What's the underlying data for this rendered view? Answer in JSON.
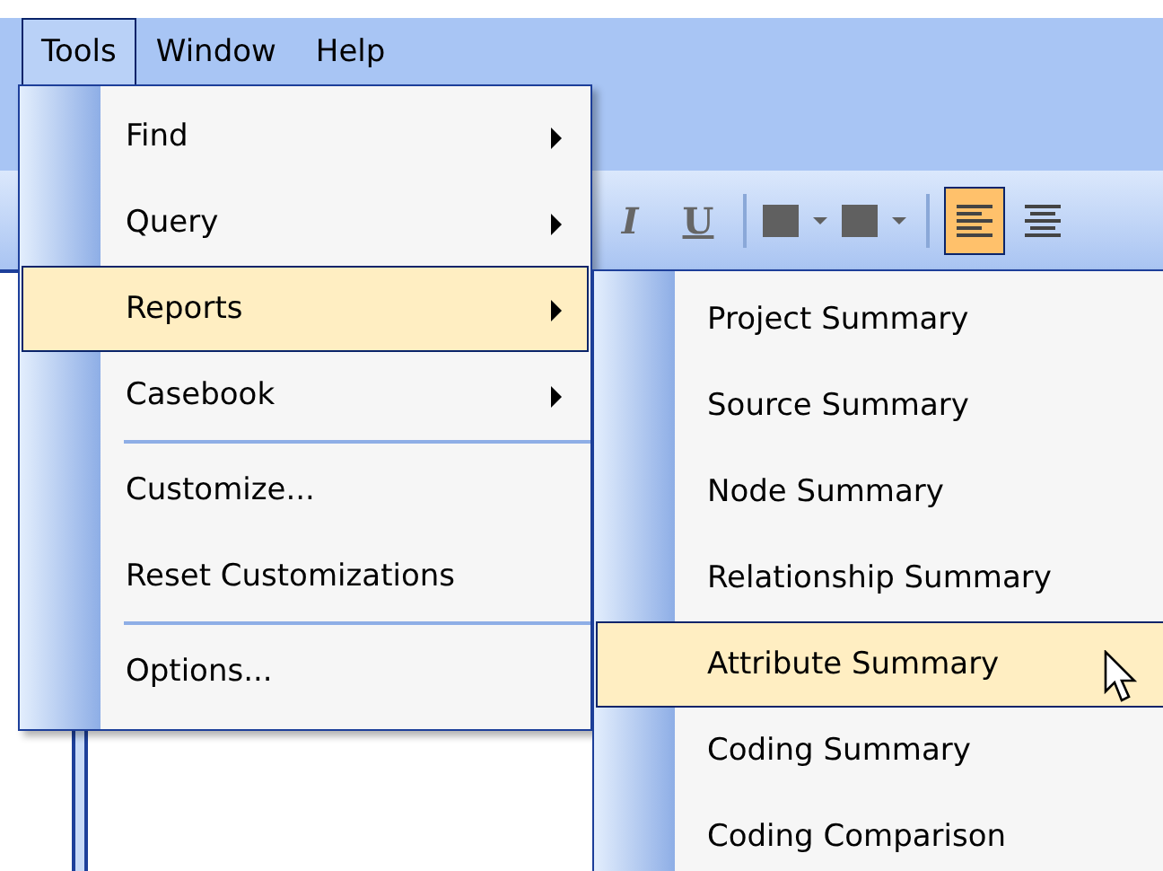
{
  "menubar": [
    {
      "label": "Tools",
      "selected": true
    },
    {
      "label": "Window",
      "selected": false
    },
    {
      "label": "Help",
      "selected": false
    }
  ],
  "toolbar": [
    {
      "kind": "italic",
      "label": "I",
      "selected": false
    },
    {
      "kind": "underline",
      "label": "U",
      "selected": false
    },
    {
      "kind": "separator"
    },
    {
      "kind": "color",
      "selected": false
    },
    {
      "kind": "color",
      "selected": false
    },
    {
      "kind": "separator"
    },
    {
      "kind": "align-left",
      "selected": true
    },
    {
      "kind": "align-center",
      "selected": false
    }
  ],
  "tools_menu": [
    {
      "kind": "item",
      "label": "Find",
      "submenu": true,
      "selected": false
    },
    {
      "kind": "item",
      "label": "Query",
      "submenu": true,
      "selected": false
    },
    {
      "kind": "item",
      "label": "Reports",
      "submenu": true,
      "selected": true
    },
    {
      "kind": "item",
      "label": "Casebook",
      "submenu": true,
      "selected": false
    },
    {
      "kind": "separator"
    },
    {
      "kind": "item",
      "label": "Customize...",
      "submenu": false,
      "selected": false
    },
    {
      "kind": "item",
      "label": "Reset Customizations",
      "submenu": false,
      "selected": false
    },
    {
      "kind": "separator"
    },
    {
      "kind": "item",
      "label": "Options...",
      "submenu": false,
      "selected": false
    }
  ],
  "reports_menu": [
    {
      "label": "Project Summary",
      "selected": false
    },
    {
      "label": "Source Summary",
      "selected": false
    },
    {
      "label": "Node Summary",
      "selected": false
    },
    {
      "label": "Relationship Summary",
      "selected": false
    },
    {
      "label": "Attribute Summary",
      "selected": true
    },
    {
      "label": "Coding Summary",
      "selected": false
    },
    {
      "label": "Coding Comparison",
      "selected": false
    }
  ]
}
